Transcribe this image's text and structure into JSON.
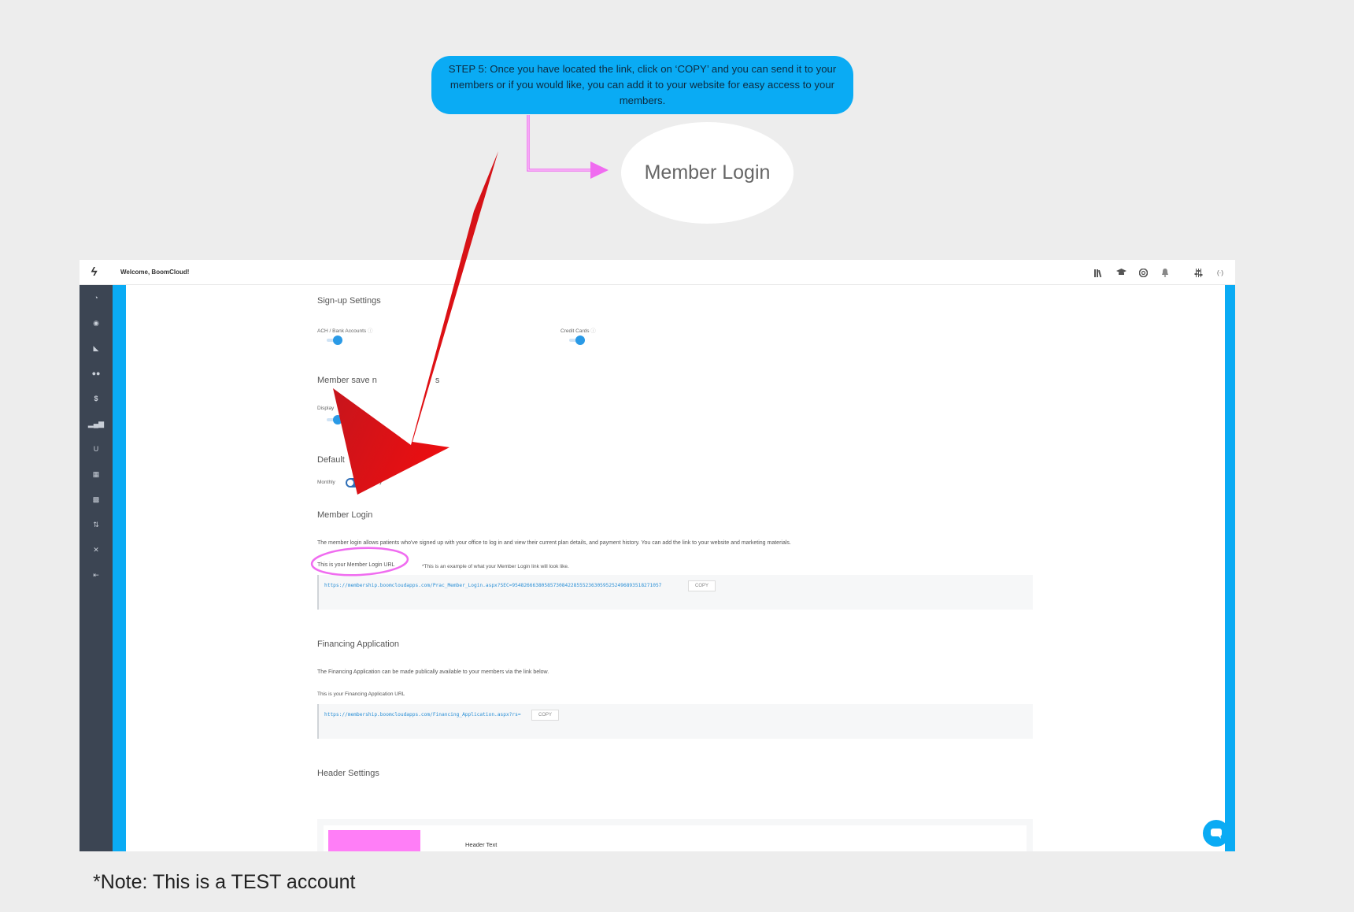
{
  "callout": {
    "text": "STEP 5: Once you have located the link, click on ‘COPY’ and you can send it to your members or if you would like, you can add it to your website for easy access to your members."
  },
  "ellipse_label": "Member Login",
  "topbar": {
    "logo": "ϟ",
    "welcome": "Welcome, BoomCloud!",
    "icons": [
      "library-icon",
      "graduation-cap-icon",
      "help-icon",
      "bell-icon",
      "sliders-icon",
      "code-icon"
    ]
  },
  "sidebar": {
    "icons": [
      "dashboard-icon",
      "compass-icon",
      "chart-down-icon",
      "users-icon",
      "dollar-icon",
      "bar-chart-icon",
      "magnet-icon",
      "calendar-icon",
      "grid-icon",
      "sort-icon",
      "tools-icon",
      "logout-icon"
    ]
  },
  "signup": {
    "title": "Sign-up Settings",
    "ach_label": "ACH / Bank Accounts",
    "cc_label": "Credit Cards"
  },
  "member_save": {
    "title_a": "Member save n",
    "title_b": "s",
    "display_label": "Display"
  },
  "default": {
    "title": "Default",
    "monthly_label": "Monthly",
    "other_label": "y"
  },
  "member_login": {
    "title": "Member Login",
    "description": "The member login allows patients who've signed up with your office to log in and view their current plan details, and payment history. You can add the link to your website and marketing materials.",
    "url_label": "This is your Member Login URL",
    "example_note": "*This is an example of what your Member Login link will look like.",
    "url": "https://membership.boomcloudapps.com/Prac_Member_Login.aspx?SEC=954826663805857308422855523630595252496893518271057",
    "copy": "COPY"
  },
  "financing": {
    "title": "Financing Application",
    "description": "The Financing Application can be made publically available to your members via the link below.",
    "url_label": "This is your Financing Application URL",
    "url": "https://membership.boomcloudapps.com/Financing_Application.aspx?rs=",
    "copy": "COPY"
  },
  "header_settings": {
    "title": "Header Settings",
    "header_text": "Header Text",
    "swatch_color": "#ff7ef7"
  },
  "note": "*Note: This is a TEST account",
  "colors": {
    "accent": "#0aabf4",
    "sidebar": "#3c4553",
    "arrow": "#e8101a",
    "annotation_pink": "#f06cf0"
  }
}
